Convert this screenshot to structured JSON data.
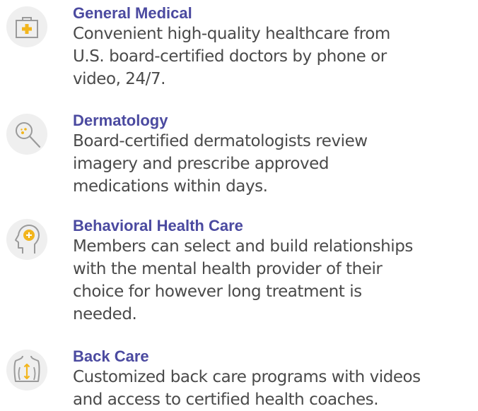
{
  "services": [
    {
      "icon": "medical-kit-icon",
      "title": "General Medical",
      "description_lines": [
        "Convenient high-quality healthcare from",
        "U.S. board-certified doctors by phone or",
        "video, 24/7."
      ]
    },
    {
      "icon": "magnifier-icon",
      "title": "Dermatology",
      "description_lines": [
        "Board-certified dermatologists review",
        "imagery and prescribe approved",
        "medications within days."
      ]
    },
    {
      "icon": "head-profile-icon",
      "title": "Behavioral Health Care",
      "description_lines": [
        "Members can select and build relationships",
        "with the mental health provider of their",
        "choice for however long treatment is",
        "needed."
      ]
    },
    {
      "icon": "back-torso-icon",
      "title": "Back Care",
      "description_lines": [
        "Customized back care programs with videos",
        "and access to certified health coaches."
      ]
    }
  ],
  "colors": {
    "title": "#4b4aa0",
    "body_text": "#4a4a4a",
    "icon_circle": "#efefef",
    "icon_stroke": "#9a9a9a",
    "accent": "#f2b51c"
  }
}
